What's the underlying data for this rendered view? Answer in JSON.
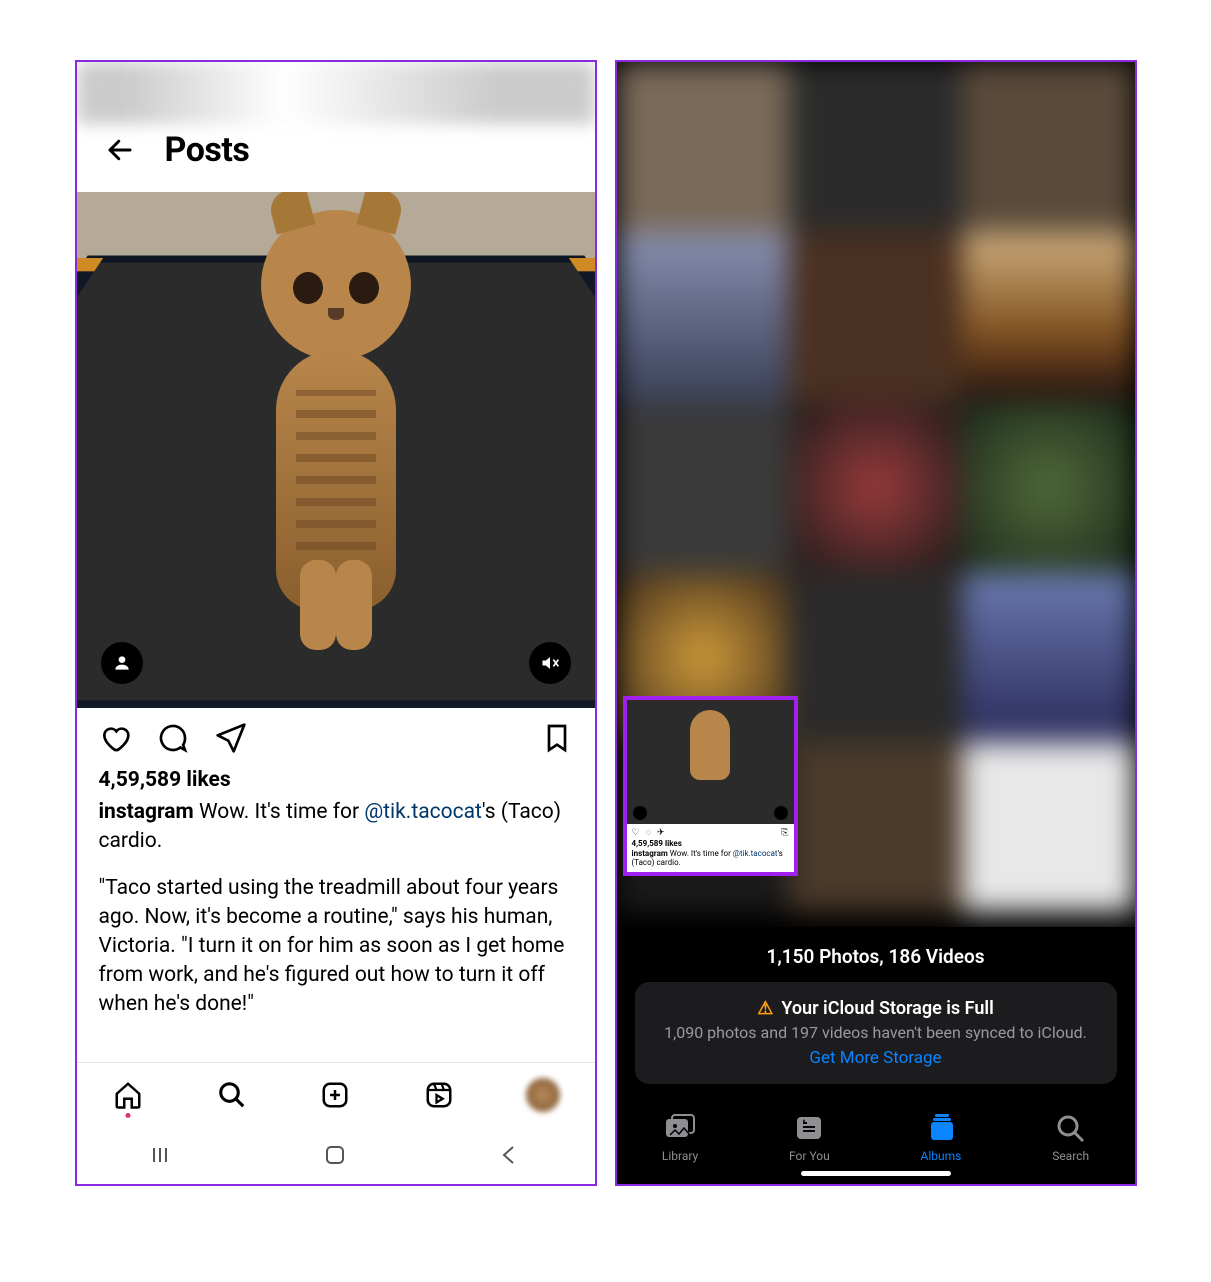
{
  "left": {
    "header_title": "Posts",
    "likes": "4,59,589 likes",
    "caption_user": "instagram",
    "caption_lead": " Wow. It's time for ",
    "caption_mention": "@tik.tacocat",
    "caption_tail": "'s (Taco) cardio.",
    "caption_body": "\"Taco started using the treadmill about four years ago. Now, it's become a routine,\" says his human, Victoria. \"I turn it on for him as soon as I get home from work, and he's figured out how to turn it off when he's done!\"",
    "icons": {
      "back": "back-arrow",
      "tag": "person-tag",
      "mute": "speaker-muted",
      "like": "heart",
      "comment": "comment",
      "send": "paper-plane",
      "save": "bookmark",
      "nav_home": "home",
      "nav_search": "search",
      "nav_new": "new-post",
      "nav_reels": "reels",
      "nav_profile": "profile"
    },
    "sysnav": {
      "recents": "≡",
      "home": "□",
      "back": "‹"
    }
  },
  "right": {
    "count_text": "1,150 Photos, 186 Videos",
    "banner_title": "Your iCloud Storage is Full",
    "banner_body": "1,090 photos and 197 videos haven't been synced to iCloud.",
    "banner_cta": "Get More Storage",
    "selected_thumb": {
      "likes": "4,59,589 likes",
      "cap_user": "instagram",
      "cap_text": " Wow. It's time for ",
      "cap_mention": "@tik.tacocat",
      "cap_tail": "'s (Taco) cardio."
    },
    "tabs": [
      {
        "id": "library",
        "label": "Library",
        "active": false
      },
      {
        "id": "foryou",
        "label": "For You",
        "active": false
      },
      {
        "id": "albums",
        "label": "Albums",
        "active": true
      },
      {
        "id": "search",
        "label": "Search",
        "active": false
      }
    ]
  }
}
